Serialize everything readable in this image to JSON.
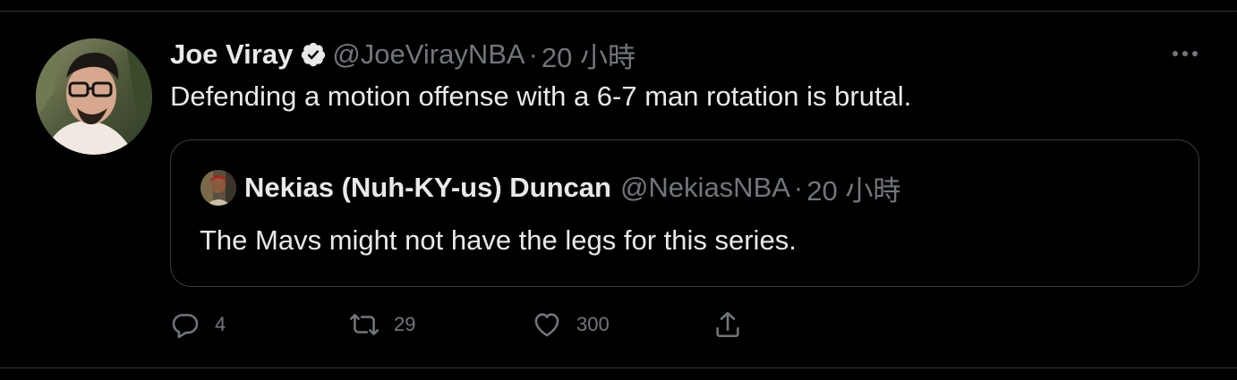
{
  "tweet": {
    "author_name": "Joe Viray",
    "handle": "@JoeVirayNBA",
    "separator": "·",
    "time": "20 小時",
    "text": "Defending a motion offense with a 6-7 man rotation is brutal.",
    "verified": true,
    "more_icon": "more-icon"
  },
  "quote": {
    "author_name": "Nekias (Nuh-KY-us) Duncan",
    "handle": "@NekiasNBA",
    "separator": "·",
    "time": "20 小時",
    "text": "The Mavs might not have the legs for this series."
  },
  "actions": {
    "reply": {
      "icon": "reply-icon",
      "count": "4"
    },
    "retweet": {
      "icon": "retweet-icon",
      "count": "29"
    },
    "like": {
      "icon": "heart-icon",
      "count": "300"
    },
    "share": {
      "icon": "share-icon"
    }
  },
  "colors": {
    "background": "#000000",
    "text_primary": "#e7e9ea",
    "text_secondary": "#71767b",
    "border": "#2f3336"
  }
}
